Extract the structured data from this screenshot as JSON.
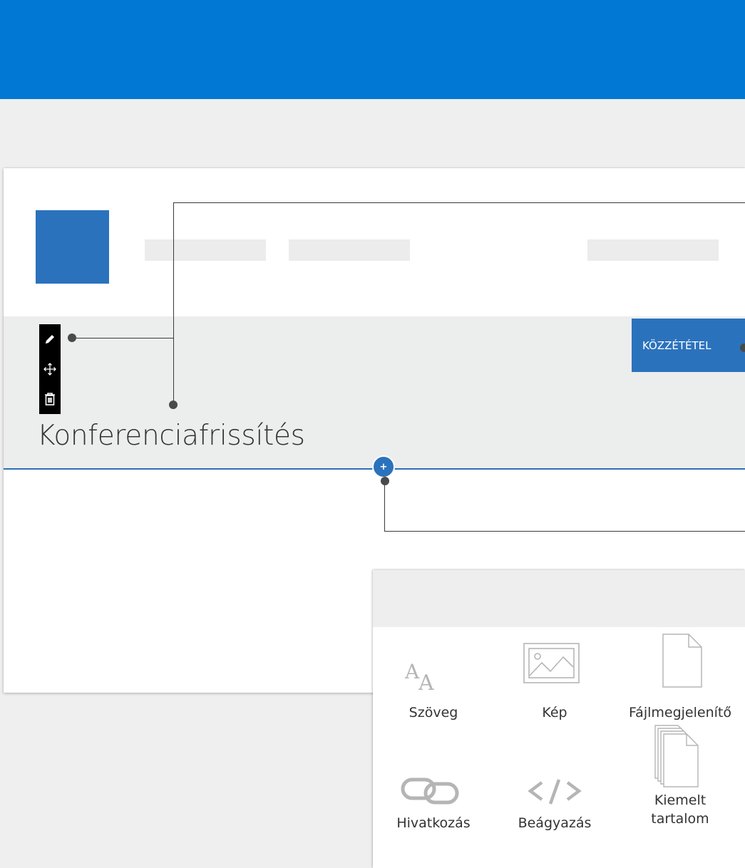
{
  "page": {
    "title": "Konferenciafrissítés",
    "publish_label": "KÖZZÉTÉTEL"
  },
  "edit_toolbar": {
    "icons": [
      "pencil-icon",
      "move-icon",
      "trash-icon"
    ]
  },
  "add_section": {
    "icon": "plus-icon",
    "label": "+"
  },
  "web_parts": [
    {
      "label": "Szöveg",
      "icon": "text-icon"
    },
    {
      "label": "Kép",
      "icon": "image-icon"
    },
    {
      "label": "Fájlmegjelenítő",
      "icon": "file-icon"
    },
    {
      "label": "Hivatkozás",
      "icon": "link-icon"
    },
    {
      "label": "Beágyazás",
      "icon": "embed-icon"
    },
    {
      "label": "Kiemelt tartalom",
      "label_lines": [
        "Kiemelt",
        "tartalom"
      ],
      "icon": "highlighted-content-icon"
    }
  ],
  "colors": {
    "brand_blue": "#0078d4",
    "accent_blue": "#2b72bd",
    "title_band": "#eceded",
    "background": "#efefef"
  }
}
